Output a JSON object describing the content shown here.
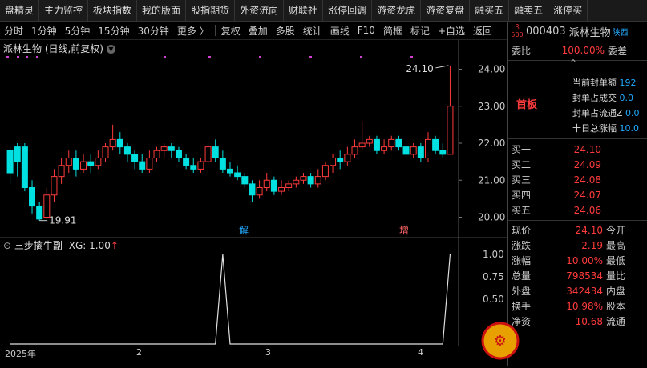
{
  "menu": [
    "盘精灵",
    "主力监控",
    "板块指数",
    "我的版面",
    "股指期货",
    "外资流向",
    "财联社",
    "涨停回调",
    "游资龙虎",
    "游资复盘",
    "融买五",
    "融卖五",
    "涨停买"
  ],
  "toolbar": [
    "分时",
    "1分钟",
    "5分钟",
    "15分钟",
    "30分钟",
    "更多 〉",
    "复权",
    "叠加",
    "多股",
    "统计",
    "画线",
    "F10",
    "简框",
    "标记",
    "+自选",
    "返回"
  ],
  "chart": {
    "title": "派林生物 (日线,前复权)",
    "high_label": "24.10",
    "low_label": "19.91",
    "event1": "解",
    "event2": "增"
  },
  "indicator": {
    "title": "三步擒牛副",
    "xg_label": "XG: 1.00"
  },
  "dates": {
    "year": "2025年",
    "m2": "2",
    "m3": "3",
    "m4": "4"
  },
  "quote": {
    "badge": "R 500",
    "code": "000403",
    "name": "派林生物",
    "region": "陕西",
    "webi_label": "委比",
    "webi": "100.00%",
    "weicha_label": "委差",
    "board": "首板",
    "info": [
      [
        "当前封单额",
        "192"
      ],
      [
        "封单占成交",
        "0.0"
      ],
      [
        "封单占流通Z",
        "0.0"
      ],
      [
        "十日总涨幅",
        "10.0"
      ]
    ],
    "buys": [
      [
        "买一",
        "24.10"
      ],
      [
        "买二",
        "24.09"
      ],
      [
        "买三",
        "24.08"
      ],
      [
        "买四",
        "24.07"
      ],
      [
        "买五",
        "24.06"
      ]
    ],
    "stats": [
      [
        "现价",
        "24.10",
        "今开"
      ],
      [
        "涨跌",
        "2.19",
        "最高"
      ],
      [
        "涨幅",
        "10.00%",
        "最低"
      ],
      [
        "总量",
        "798534",
        "量比"
      ],
      [
        "外盘",
        "342434",
        "内盘"
      ],
      [
        "换手",
        "10.98%",
        "股本"
      ],
      [
        "净资",
        "10.68",
        "流通"
      ]
    ]
  },
  "chart_data": {
    "type": "candlestick",
    "ylim": [
      19.6,
      24.4
    ],
    "yticks": [
      20.0,
      21.0,
      22.0,
      23.0,
      24.0
    ],
    "indicator_yticks": [
      0.25,
      0.5,
      0.75,
      1.0
    ],
    "candles": [
      [
        21.8,
        21.2,
        21.9,
        20.9
      ],
      [
        21.9,
        21.5,
        22.0,
        21.1
      ],
      [
        21.9,
        20.8,
        22.0,
        20.7
      ],
      [
        20.8,
        20.3,
        21.0,
        20.1
      ],
      [
        20.3,
        19.95,
        20.4,
        19.91
      ],
      [
        20.0,
        20.6,
        20.8,
        19.95
      ],
      [
        20.6,
        21.1,
        21.3,
        20.4
      ],
      [
        21.1,
        21.4,
        21.6,
        20.9
      ],
      [
        21.4,
        21.6,
        21.8,
        21.2
      ],
      [
        21.6,
        21.3,
        21.8,
        21.1
      ],
      [
        21.3,
        21.5,
        21.7,
        21.2
      ],
      [
        21.5,
        21.4,
        21.7,
        21.2
      ],
      [
        21.4,
        21.6,
        21.8,
        21.3
      ],
      [
        21.6,
        21.9,
        22.0,
        21.5
      ],
      [
        21.9,
        22.1,
        22.5,
        21.8
      ],
      [
        22.1,
        21.9,
        22.3,
        21.7
      ],
      [
        21.9,
        21.7,
        22.0,
        21.5
      ],
      [
        21.7,
        21.5,
        21.8,
        21.3
      ],
      [
        21.5,
        21.3,
        21.7,
        21.2
      ],
      [
        21.3,
        21.6,
        21.8,
        21.2
      ],
      [
        21.6,
        21.8,
        21.9,
        21.5
      ],
      [
        21.8,
        21.9,
        22.0,
        21.6
      ],
      [
        21.9,
        21.8,
        22.0,
        21.6
      ],
      [
        21.8,
        21.6,
        21.9,
        21.5
      ],
      [
        21.6,
        21.4,
        21.7,
        21.3
      ],
      [
        21.4,
        21.3,
        21.6,
        21.2
      ],
      [
        21.3,
        21.5,
        21.6,
        21.2
      ],
      [
        21.5,
        21.9,
        22.0,
        21.4
      ],
      [
        21.9,
        21.6,
        22.1,
        21.5
      ],
      [
        21.6,
        21.3,
        21.8,
        21.2
      ],
      [
        21.3,
        21.2,
        21.5,
        21.1
      ],
      [
        21.2,
        21.1,
        21.4,
        21.0
      ],
      [
        21.1,
        20.9,
        21.2,
        20.8
      ],
      [
        20.9,
        20.6,
        21.0,
        20.4
      ],
      [
        20.6,
        20.8,
        21.0,
        20.5
      ],
      [
        20.8,
        21.0,
        21.2,
        20.7
      ],
      [
        21.0,
        20.7,
        21.1,
        20.6
      ],
      [
        20.7,
        20.8,
        21.0,
        20.6
      ],
      [
        20.8,
        20.9,
        21.0,
        20.7
      ],
      [
        20.9,
        21.0,
        21.1,
        20.8
      ],
      [
        21.0,
        21.1,
        21.2,
        20.9
      ],
      [
        21.1,
        20.9,
        21.2,
        20.8
      ],
      [
        20.9,
        21.1,
        21.3,
        20.8
      ],
      [
        21.1,
        21.4,
        21.5,
        21.0
      ],
      [
        21.4,
        21.6,
        21.7,
        21.2
      ],
      [
        21.6,
        21.5,
        21.8,
        21.3
      ],
      [
        21.5,
        21.7,
        21.9,
        21.4
      ],
      [
        21.7,
        21.9,
        22.1,
        21.6
      ],
      [
        21.9,
        22.0,
        22.6,
        21.8
      ],
      [
        22.0,
        22.1,
        22.2,
        21.9
      ],
      [
        22.1,
        21.8,
        22.2,
        21.7
      ],
      [
        21.8,
        21.9,
        22.1,
        21.7
      ],
      [
        21.9,
        22.1,
        22.2,
        21.8
      ],
      [
        22.1,
        21.9,
        22.2,
        21.8
      ],
      [
        21.9,
        21.7,
        22.0,
        21.6
      ],
      [
        21.7,
        21.9,
        22.0,
        21.6
      ],
      [
        21.9,
        21.6,
        22.0,
        21.5
      ],
      [
        21.6,
        22.1,
        22.3,
        21.5
      ],
      [
        22.1,
        21.8,
        22.2,
        21.7
      ],
      [
        21.8,
        21.7,
        22.0,
        21.6
      ],
      [
        21.7,
        23.0,
        24.1,
        21.7
      ]
    ],
    "xg": [
      0,
      0,
      0,
      0,
      0,
      0,
      0,
      0,
      0,
      0,
      0,
      0,
      0,
      0,
      0,
      0,
      0,
      0,
      0,
      0,
      0,
      0,
      0,
      0,
      0,
      0,
      0,
      0,
      0,
      1,
      0,
      0,
      0,
      0,
      0,
      0,
      0,
      0,
      0,
      0,
      0,
      0,
      0,
      0,
      0,
      0,
      0,
      0,
      0,
      0,
      0,
      0,
      0,
      0,
      0,
      0,
      0,
      0,
      0,
      0,
      1
    ]
  },
  "colors": {
    "up": "#ff3b3b",
    "down": "#00e0e0",
    "axis": "#c8c8c8"
  }
}
